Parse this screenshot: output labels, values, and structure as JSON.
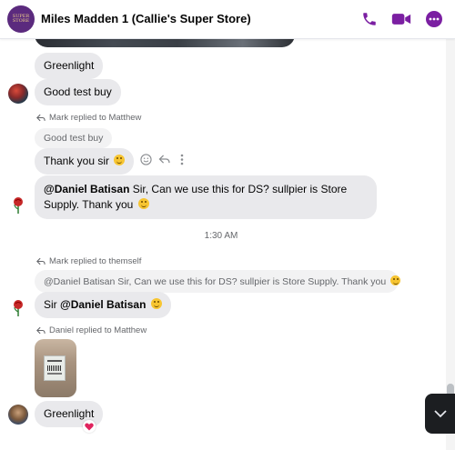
{
  "header": {
    "title": "Miles Madden 1 (Callie's Super Store)",
    "avatar_text": "SUPER STORE",
    "accent_color": "#7b1fa2"
  },
  "messages": {
    "m1": "Greenlight",
    "m2": "Good test buy",
    "reply1": {
      "note": "Mark replied to Matthew",
      "quoted": "Good test buy",
      "text": "Thank you sir"
    },
    "m4": {
      "mention": "@Daniel Batisan",
      "text": " Sir, Can we use this for DS? sullpier is Store Supply. Thank you"
    },
    "timestamp": "1:30 AM",
    "reply2": {
      "note": "Mark replied to themself",
      "quoted": "@Daniel Batisan Sir, Can we use this for DS? sullpier is Store Supply. Thank you",
      "text_prefix": "Sir ",
      "mention": "@Daniel Batisan"
    },
    "reply3": {
      "note": "Daniel replied to Matthew",
      "text": "Greenlight",
      "reaction": "❤️"
    }
  },
  "icons": {
    "call": "phone-icon",
    "video": "video-camera-icon",
    "more": "more-options-icon",
    "reply": "reply-arrow-icon",
    "react": "smiley-face-icon",
    "menu": "vertical-dots-icon",
    "scroll": "chevron-down-icon"
  }
}
